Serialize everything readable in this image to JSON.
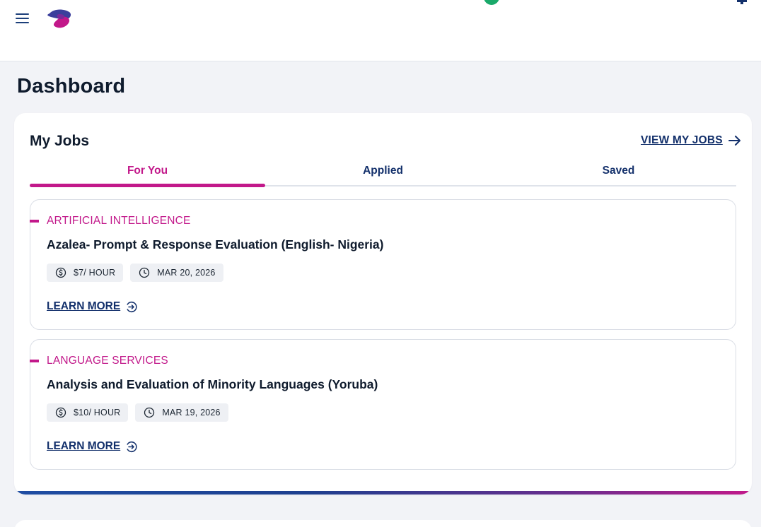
{
  "header": {
    "menu_icon": "hamburger-menu-icon",
    "logo_icon": "brand-logo-icon",
    "bell_icon": "bell-icon",
    "colors": {
      "logo_primary": "#c2188a",
      "logo_secondary": "#3b3f9c",
      "status": "#1aa96a"
    }
  },
  "page": {
    "title": "Dashboard"
  },
  "my_jobs": {
    "title": "My Jobs",
    "view_link": "VIEW MY JOBS",
    "view_link_icon": "arrow-right-icon",
    "tabs": [
      {
        "label": "For You",
        "active": true
      },
      {
        "label": "Applied",
        "active": false
      },
      {
        "label": "Saved",
        "active": false
      }
    ],
    "jobs": [
      {
        "category": "ARTIFICIAL INTELLIGENCE",
        "title": "Azalea- Prompt & Response Evaluation (English- Nigeria)",
        "pay": "$7/ HOUR",
        "date": "MAR 20, 2026",
        "learn_more": "LEARN MORE"
      },
      {
        "category": "LANGUAGE SERVICES",
        "title": "Analysis and Evaluation of Minority Languages (Yoruba)",
        "pay": "$10/ HOUR",
        "date": "MAR 19, 2026",
        "learn_more": "LEARN MORE"
      }
    ]
  },
  "colors": {
    "accent": "#c2188a",
    "link": "#13306b",
    "text": "#0f1b2d",
    "chip_bg": "#eef0f4"
  }
}
